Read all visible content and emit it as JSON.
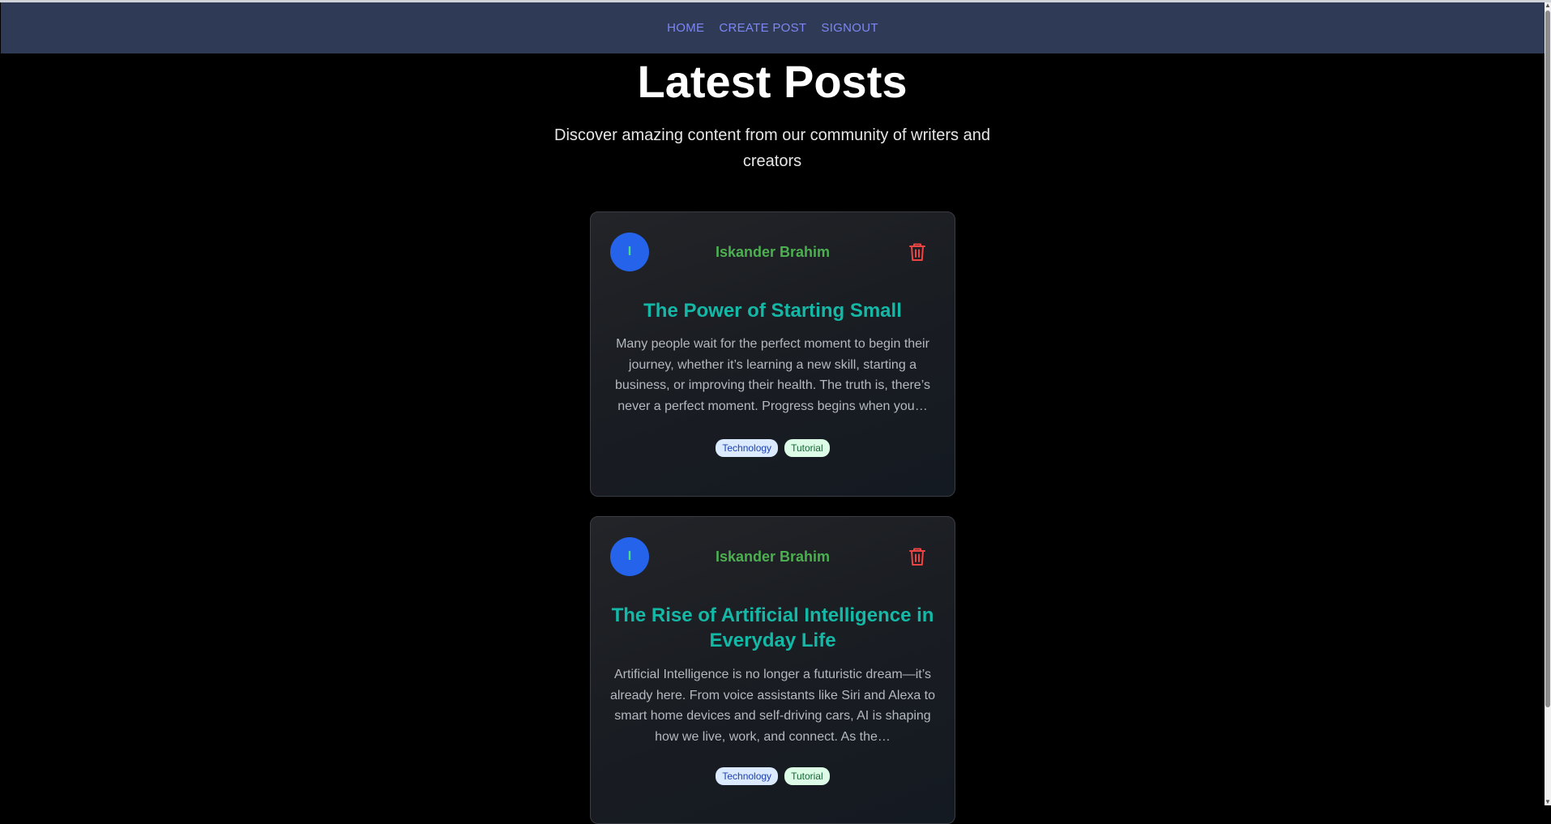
{
  "nav": {
    "items": [
      {
        "label": "HOME"
      },
      {
        "label": "CREATE POST"
      },
      {
        "label": "SIGNOUT"
      }
    ]
  },
  "hero": {
    "title": "Latest Posts",
    "subtitle": "Discover amazing content from our community of writers and creators"
  },
  "posts": [
    {
      "avatar_initial": "I",
      "author": "Iskander Brahim",
      "title": "The Power of Starting Small",
      "excerpt": "Many people wait for the perfect moment to begin their journey, whether it’s learning a new skill, starting a business, or improving their health. The truth is, there’s never a perfect moment. Progress begins when you…",
      "tags": [
        "Technology",
        "Tutorial"
      ],
      "delete_icon": "trash-icon"
    },
    {
      "avatar_initial": "I",
      "author": "Iskander Brahim",
      "title": "The Rise of Artificial Intelligence in Everyday Life",
      "excerpt": "Artificial Intelligence is no longer a futuristic dream—it’s already here. From voice assistants like Siri and Alexa to smart home devices and self-driving cars, AI is shaping how we live, work, and connect. As the…",
      "tags": [
        "Technology",
        "Tutorial"
      ],
      "delete_icon": "trash-icon"
    }
  ],
  "colors": {
    "navbar_bg": "#2f3b56",
    "nav_link": "#7c86f5",
    "avatar_bg": "#2563eb",
    "author": "#4caf50",
    "post_title": "#14b8a6",
    "delete": "#ef4444"
  }
}
